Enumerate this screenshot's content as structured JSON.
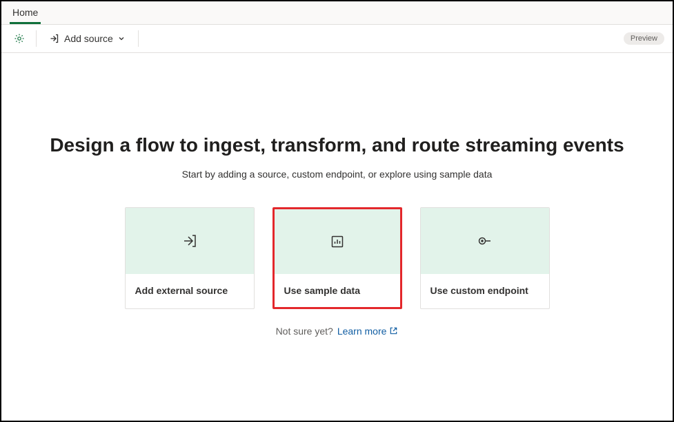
{
  "tabs": {
    "home": "Home"
  },
  "toolbar": {
    "add_source_label": "Add source",
    "preview_badge": "Preview"
  },
  "main": {
    "heading": "Design a flow to ingest, transform, and route streaming events",
    "subheading": "Start by adding a source, custom endpoint, or explore using sample data",
    "cards": {
      "external_source": "Add external source",
      "sample_data": "Use sample data",
      "custom_endpoint": "Use custom endpoint"
    },
    "footer": {
      "not_sure": "Not sure yet?",
      "learn_more": "Learn more"
    }
  }
}
